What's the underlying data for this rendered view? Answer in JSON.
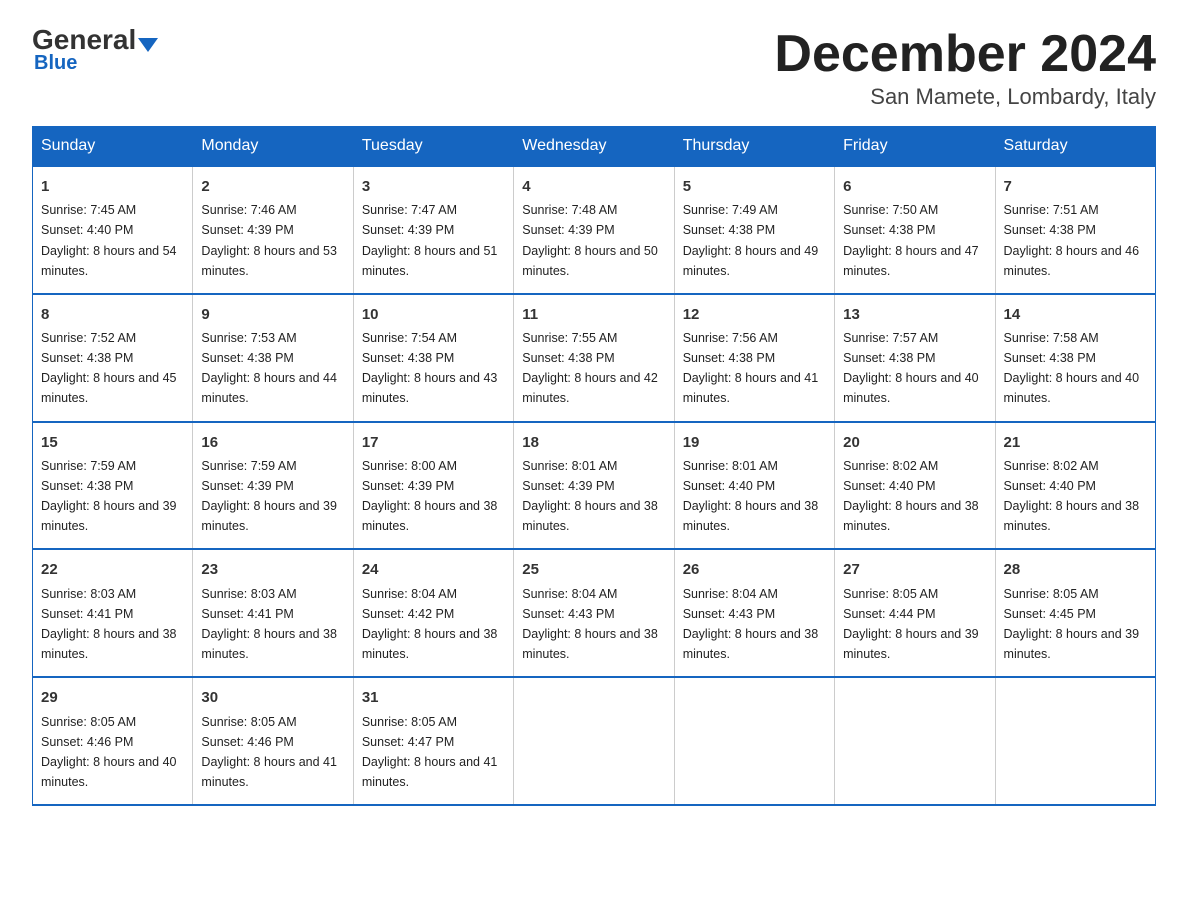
{
  "header": {
    "logo_general": "General",
    "logo_blue": "Blue",
    "month_title": "December 2024",
    "location": "San Mamete, Lombardy, Italy"
  },
  "days_of_week": [
    "Sunday",
    "Monday",
    "Tuesday",
    "Wednesday",
    "Thursday",
    "Friday",
    "Saturday"
  ],
  "weeks": [
    [
      {
        "day": "1",
        "sunrise": "7:45 AM",
        "sunset": "4:40 PM",
        "daylight": "8 hours and 54 minutes."
      },
      {
        "day": "2",
        "sunrise": "7:46 AM",
        "sunset": "4:39 PM",
        "daylight": "8 hours and 53 minutes."
      },
      {
        "day": "3",
        "sunrise": "7:47 AM",
        "sunset": "4:39 PM",
        "daylight": "8 hours and 51 minutes."
      },
      {
        "day": "4",
        "sunrise": "7:48 AM",
        "sunset": "4:39 PM",
        "daylight": "8 hours and 50 minutes."
      },
      {
        "day": "5",
        "sunrise": "7:49 AM",
        "sunset": "4:38 PM",
        "daylight": "8 hours and 49 minutes."
      },
      {
        "day": "6",
        "sunrise": "7:50 AM",
        "sunset": "4:38 PM",
        "daylight": "8 hours and 47 minutes."
      },
      {
        "day": "7",
        "sunrise": "7:51 AM",
        "sunset": "4:38 PM",
        "daylight": "8 hours and 46 minutes."
      }
    ],
    [
      {
        "day": "8",
        "sunrise": "7:52 AM",
        "sunset": "4:38 PM",
        "daylight": "8 hours and 45 minutes."
      },
      {
        "day": "9",
        "sunrise": "7:53 AM",
        "sunset": "4:38 PM",
        "daylight": "8 hours and 44 minutes."
      },
      {
        "day": "10",
        "sunrise": "7:54 AM",
        "sunset": "4:38 PM",
        "daylight": "8 hours and 43 minutes."
      },
      {
        "day": "11",
        "sunrise": "7:55 AM",
        "sunset": "4:38 PM",
        "daylight": "8 hours and 42 minutes."
      },
      {
        "day": "12",
        "sunrise": "7:56 AM",
        "sunset": "4:38 PM",
        "daylight": "8 hours and 41 minutes."
      },
      {
        "day": "13",
        "sunrise": "7:57 AM",
        "sunset": "4:38 PM",
        "daylight": "8 hours and 40 minutes."
      },
      {
        "day": "14",
        "sunrise": "7:58 AM",
        "sunset": "4:38 PM",
        "daylight": "8 hours and 40 minutes."
      }
    ],
    [
      {
        "day": "15",
        "sunrise": "7:59 AM",
        "sunset": "4:38 PM",
        "daylight": "8 hours and 39 minutes."
      },
      {
        "day": "16",
        "sunrise": "7:59 AM",
        "sunset": "4:39 PM",
        "daylight": "8 hours and 39 minutes."
      },
      {
        "day": "17",
        "sunrise": "8:00 AM",
        "sunset": "4:39 PM",
        "daylight": "8 hours and 38 minutes."
      },
      {
        "day": "18",
        "sunrise": "8:01 AM",
        "sunset": "4:39 PM",
        "daylight": "8 hours and 38 minutes."
      },
      {
        "day": "19",
        "sunrise": "8:01 AM",
        "sunset": "4:40 PM",
        "daylight": "8 hours and 38 minutes."
      },
      {
        "day": "20",
        "sunrise": "8:02 AM",
        "sunset": "4:40 PM",
        "daylight": "8 hours and 38 minutes."
      },
      {
        "day": "21",
        "sunrise": "8:02 AM",
        "sunset": "4:40 PM",
        "daylight": "8 hours and 38 minutes."
      }
    ],
    [
      {
        "day": "22",
        "sunrise": "8:03 AM",
        "sunset": "4:41 PM",
        "daylight": "8 hours and 38 minutes."
      },
      {
        "day": "23",
        "sunrise": "8:03 AM",
        "sunset": "4:41 PM",
        "daylight": "8 hours and 38 minutes."
      },
      {
        "day": "24",
        "sunrise": "8:04 AM",
        "sunset": "4:42 PM",
        "daylight": "8 hours and 38 minutes."
      },
      {
        "day": "25",
        "sunrise": "8:04 AM",
        "sunset": "4:43 PM",
        "daylight": "8 hours and 38 minutes."
      },
      {
        "day": "26",
        "sunrise": "8:04 AM",
        "sunset": "4:43 PM",
        "daylight": "8 hours and 38 minutes."
      },
      {
        "day": "27",
        "sunrise": "8:05 AM",
        "sunset": "4:44 PM",
        "daylight": "8 hours and 39 minutes."
      },
      {
        "day": "28",
        "sunrise": "8:05 AM",
        "sunset": "4:45 PM",
        "daylight": "8 hours and 39 minutes."
      }
    ],
    [
      {
        "day": "29",
        "sunrise": "8:05 AM",
        "sunset": "4:46 PM",
        "daylight": "8 hours and 40 minutes."
      },
      {
        "day": "30",
        "sunrise": "8:05 AM",
        "sunset": "4:46 PM",
        "daylight": "8 hours and 41 minutes."
      },
      {
        "day": "31",
        "sunrise": "8:05 AM",
        "sunset": "4:47 PM",
        "daylight": "8 hours and 41 minutes."
      },
      null,
      null,
      null,
      null
    ]
  ],
  "labels": {
    "sunrise": "Sunrise:",
    "sunset": "Sunset:",
    "daylight": "Daylight:"
  }
}
